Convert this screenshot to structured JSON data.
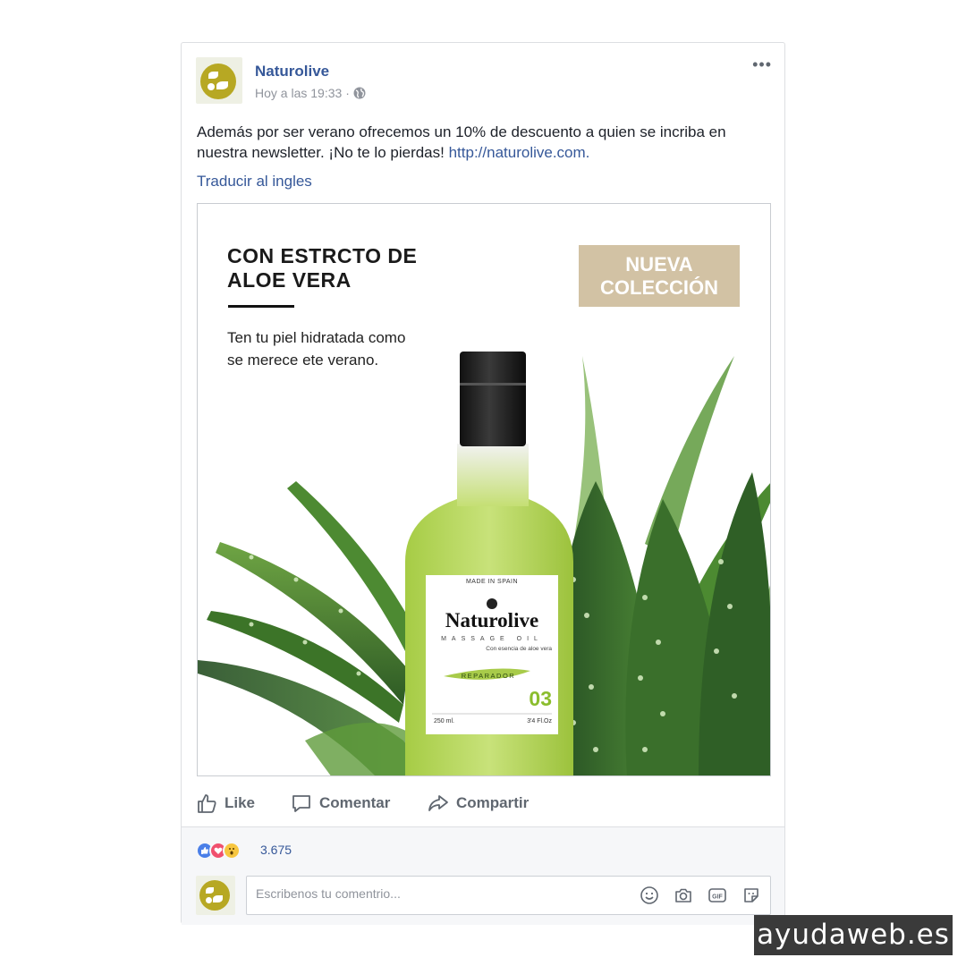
{
  "post": {
    "page_name": "Naturolive",
    "time": "Hoy a las 19:33",
    "separator": "·",
    "text": "Además por ser verano ofrecemos un 10% de descuento a quien se incriba en nuestra newsletter. ¡No te lo pierdas! ",
    "link": "http://naturolive.com.",
    "translate": "Traducir al ingles",
    "more": "•••"
  },
  "ad": {
    "headline_1": "CON ESTRCTO DE",
    "headline_2": "ALOE VERA",
    "subline_1": "Ten tu piel hidratada como",
    "subline_2": "se merece ete verano.",
    "badge_1": "NUEVA",
    "badge_2": "COLECCIÓN",
    "label": {
      "made_in": "MADE IN SPAIN",
      "brand": "Naturolive",
      "product": "MASSAGE OIL",
      "essence": "Con esencia de aloe vera",
      "variant": "REPARADOR",
      "number": "03",
      "volume_ml": "250 ml.",
      "volume_oz": "3'4 Fl.Oz"
    }
  },
  "actions": {
    "like": "Like",
    "comment": "Comentar",
    "share": "Compartir"
  },
  "reactions": {
    "count": "3.675"
  },
  "comment": {
    "placeholder": "Escribenos tu comentrio..."
  },
  "watermark": "ayudaweb.es",
  "colors": {
    "link": "#365899",
    "badge": "#d2c2a4",
    "bottle": "#b6d65a",
    "aloe": "#3f7a2c"
  }
}
